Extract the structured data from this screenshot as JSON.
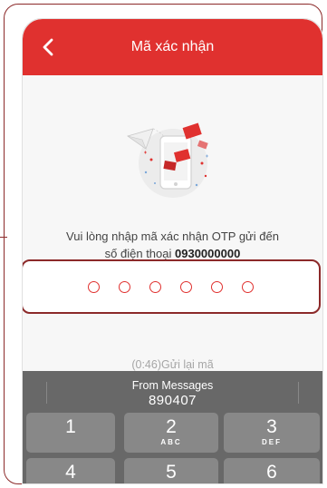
{
  "header": {
    "title": "Mã xác nhận"
  },
  "message": {
    "line1": "Vui lòng nhập mã xác nhận OTP gửi đến",
    "line2_prefix": "số điện thoại",
    "phone_number": "0930000000"
  },
  "otp": {
    "length": 6,
    "value": ""
  },
  "resend": {
    "countdown": "(0:46)",
    "label": "Gửi lại mã"
  },
  "keyboard": {
    "suggestion_title": "From Messages",
    "suggestion_code": "890407",
    "keys": [
      {
        "num": "1",
        "letters": ""
      },
      {
        "num": "2",
        "letters": "ABC"
      },
      {
        "num": "3",
        "letters": "DEF"
      },
      {
        "num": "4",
        "letters": ""
      },
      {
        "num": "5",
        "letters": ""
      },
      {
        "num": "6",
        "letters": ""
      }
    ]
  },
  "colors": {
    "brand": "#e0312f",
    "accent_border": "#8c2a2a",
    "keyboard_bg": "#686868",
    "key_bg": "#888888"
  }
}
